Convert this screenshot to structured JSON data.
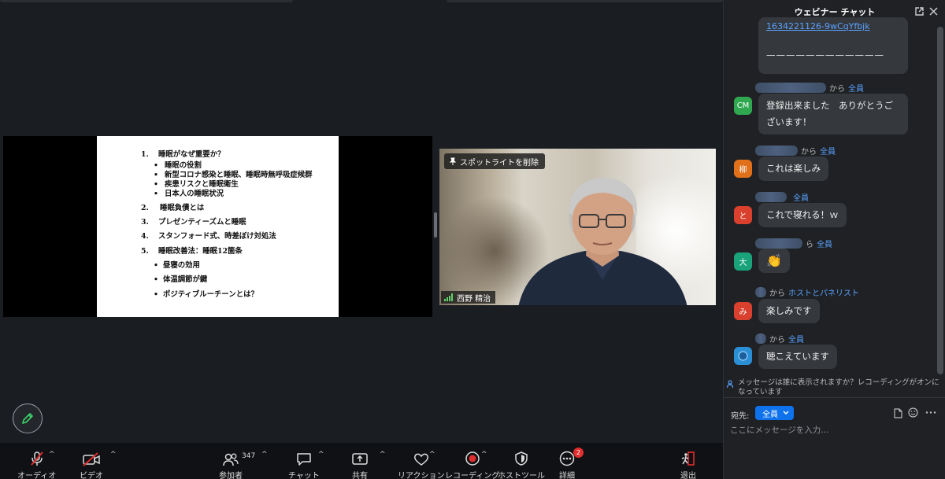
{
  "slide": {
    "items": [
      {
        "num": "1.",
        "text": "睡眠がなぜ重要か？"
      },
      {
        "bullet": "•",
        "text": "睡眠の役割"
      },
      {
        "bullet": "•",
        "text": "新型コロナ感染と睡眠、睡眠時無呼吸症候群"
      },
      {
        "bullet": "•",
        "text": "疾患リスクと睡眠衛生"
      },
      {
        "bullet": "•",
        "text": "日本人の睡眠状況"
      },
      {
        "num": "2.",
        "text": "睡眠負債とは"
      },
      {
        "num": "3.",
        "text": "プレゼンティーズムと睡眠"
      },
      {
        "num": "4.",
        "text": "スタンフォード式、時差ぼけ対処法"
      },
      {
        "num": "5.",
        "text": "睡眠改善法：睡眠12箇条"
      },
      {
        "bullet": "•",
        "text": "昼寝の効用"
      },
      {
        "bullet": "•",
        "text": "体温調節が鍵"
      },
      {
        "bullet": "•",
        "text": "ポジティブルーチーンとは？"
      }
    ]
  },
  "video": {
    "spotlight_label": "スポットライトを削除",
    "speaker_name": "西野 精治"
  },
  "toolbar": {
    "audio": "オーディオ",
    "video": "ビデオ",
    "participants": "参加者",
    "participants_count": "347",
    "chat": "チャット",
    "share": "共有",
    "reaction": "リアクション",
    "recording": "レコーディング",
    "host_tools": "ホストツール",
    "more": "詳細",
    "more_badge": "2",
    "leave": "退出",
    "caret": "^"
  },
  "chat": {
    "title": "ウェビナー チャット",
    "top_message": {
      "link": "1634221126-9wCqYfbjk",
      "dashes": "————————————"
    },
    "messages": [
      {
        "avatar": "CM",
        "color": "#2fa84f",
        "from_suffix": "から",
        "to": "全員",
        "text": "登録出来ました　ありがとうございます！"
      },
      {
        "avatar": "柳",
        "color": "#e0701a",
        "from_suffix": "から",
        "to": "全員",
        "text": "これは楽しみ"
      },
      {
        "avatar": "と",
        "color": "#d9412e",
        "from_suffix": "",
        "to": "全員",
        "text": "これで寝れる！ｗ"
      },
      {
        "avatar": "大",
        "color": "#1aa37a",
        "from_suffix": "ら",
        "to": "全員",
        "text": "👏"
      },
      {
        "avatar": "み",
        "color": "#d9412e",
        "from_suffix": "から",
        "to": "ホストとパネリスト",
        "text": "楽しみです"
      },
      {
        "avatar": "",
        "color": "#2b8fd6",
        "from_suffix": "から",
        "to": "全員",
        "text": "聴こえています"
      }
    ],
    "notice": "メッセージは誰に表示されますか？レコーディングがオンになっています",
    "to_label": "宛先:",
    "to_value": "全員",
    "input_placeholder": "ここにメッセージを入力..."
  }
}
